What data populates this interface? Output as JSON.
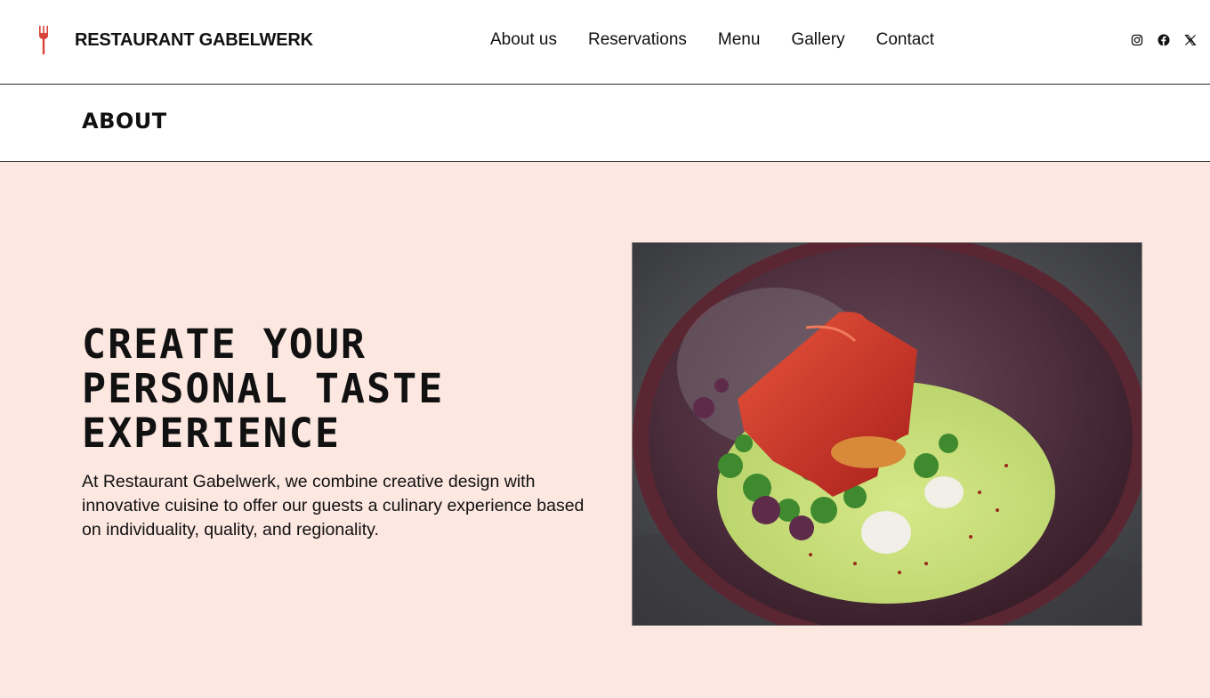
{
  "brand": {
    "name": "RESTAURANT GABELWERK",
    "logo_icon": "fork-icon",
    "logo_color": "#d9443b"
  },
  "nav": {
    "items": [
      {
        "label": "About us"
      },
      {
        "label": "Reservations"
      },
      {
        "label": "Menu"
      },
      {
        "label": "Gallery"
      },
      {
        "label": "Contact"
      }
    ]
  },
  "social": {
    "icons": [
      "instagram-icon",
      "facebook-icon",
      "x-icon"
    ]
  },
  "section": {
    "title": "ABOUT"
  },
  "hero": {
    "heading": "CREATE YOUR\nPERSONAL TASTE\nEXPERIENCE",
    "body": "At Restaurant Gabelwerk, we combine creative design with innovative cuisine to offer our guests a culinary experience based on individuality, quality, and regionality.",
    "background": "#fce7e1"
  }
}
